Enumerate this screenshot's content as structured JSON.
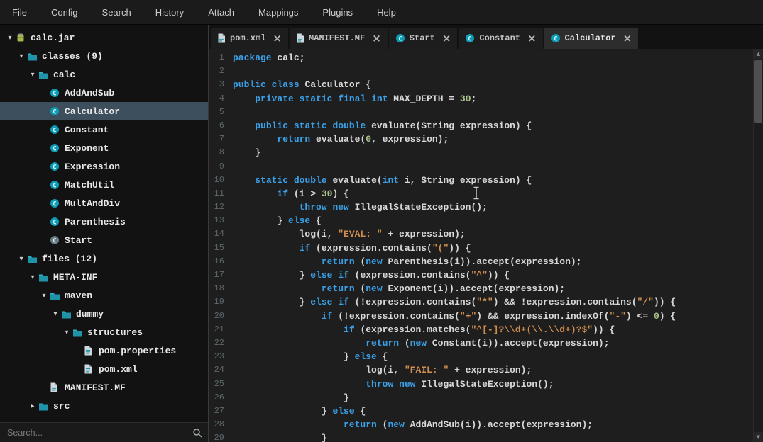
{
  "colors": {
    "accent_teal": "#1f93a8",
    "keyword_blue": "#3aa0e8",
    "string_orange": "#cf8e4e",
    "number_green": "#aac38c",
    "selection_bg": "#3d4f5d"
  },
  "icons": {
    "scroll_up": "▲",
    "scroll_down": "▼",
    "close": "×",
    "collapse": "▾",
    "expand": "▸"
  },
  "menubar": {
    "items": [
      "File",
      "Config",
      "Search",
      "History",
      "Attach",
      "Mappings",
      "Plugins",
      "Help"
    ]
  },
  "sidebar": {
    "tree": [
      {
        "label": "calc.jar",
        "level": 0,
        "icon": "jar",
        "arrow": "down"
      },
      {
        "label": "classes (9)",
        "level": 1,
        "icon": "folder",
        "arrow": "down"
      },
      {
        "label": "calc",
        "level": 2,
        "icon": "folder",
        "arrow": "down"
      },
      {
        "label": "AddAndSub",
        "level": 3,
        "icon": "class"
      },
      {
        "label": "Calculator",
        "level": 3,
        "icon": "class",
        "selected": true
      },
      {
        "label": "Constant",
        "level": 3,
        "icon": "class"
      },
      {
        "label": "Exponent",
        "level": 3,
        "icon": "class"
      },
      {
        "label": "Expression",
        "level": 3,
        "icon": "class"
      },
      {
        "label": "MatchUtil",
        "level": 3,
        "icon": "class"
      },
      {
        "label": "MultAndDiv",
        "level": 3,
        "icon": "class"
      },
      {
        "label": "Parenthesis",
        "level": 3,
        "icon": "class"
      },
      {
        "label": "Start",
        "level": 3,
        "icon": "class-gray"
      },
      {
        "label": "files (12)",
        "level": 1,
        "icon": "folder",
        "arrow": "down"
      },
      {
        "label": "META-INF",
        "level": 2,
        "icon": "folder",
        "arrow": "down"
      },
      {
        "label": "maven",
        "level": 3,
        "icon": "folder",
        "arrow": "down"
      },
      {
        "label": "dummy",
        "level": 4,
        "icon": "folder",
        "arrow": "down"
      },
      {
        "label": "structures",
        "level": 5,
        "icon": "folder",
        "arrow": "down"
      },
      {
        "label": "pom.properties",
        "level": 6,
        "icon": "file"
      },
      {
        "label": "pom.xml",
        "level": 6,
        "icon": "file"
      },
      {
        "label": "MANIFEST.MF",
        "level": 3,
        "icon": "file"
      },
      {
        "label": "src",
        "level": 2,
        "icon": "folder",
        "arrow": "right"
      }
    ],
    "search": {
      "placeholder": "Search..."
    }
  },
  "tabs": [
    {
      "label": "pom.xml",
      "icon": "file",
      "active": false
    },
    {
      "label": "MANIFEST.MF",
      "icon": "file",
      "active": false
    },
    {
      "label": "Start",
      "icon": "class",
      "active": false
    },
    {
      "label": "Constant",
      "icon": "class",
      "active": false
    },
    {
      "label": "Calculator",
      "icon": "class",
      "active": true
    }
  ],
  "editor": {
    "lines": [
      [
        [
          "kw",
          "package"
        ],
        [
          "pl",
          " calc;"
        ]
      ],
      [],
      [
        [
          "kw",
          "public"
        ],
        [
          "pl",
          " "
        ],
        [
          "kw",
          "class"
        ],
        [
          "pl",
          " Calculator {"
        ]
      ],
      [
        [
          "pl",
          "    "
        ],
        [
          "kw",
          "private"
        ],
        [
          "pl",
          " "
        ],
        [
          "kw",
          "static"
        ],
        [
          "pl",
          " "
        ],
        [
          "kw",
          "final"
        ],
        [
          "pl",
          " "
        ],
        [
          "kw",
          "int"
        ],
        [
          "pl",
          " MAX_DEPTH = "
        ],
        [
          "num",
          "30"
        ],
        [
          "pl",
          ";"
        ]
      ],
      [],
      [
        [
          "pl",
          "    "
        ],
        [
          "kw",
          "public"
        ],
        [
          "pl",
          " "
        ],
        [
          "kw",
          "static"
        ],
        [
          "pl",
          " "
        ],
        [
          "kw",
          "double"
        ],
        [
          "pl",
          " evaluate(String expression) {"
        ]
      ],
      [
        [
          "pl",
          "        "
        ],
        [
          "kw",
          "return"
        ],
        [
          "pl",
          " evaluate("
        ],
        [
          "num",
          "0"
        ],
        [
          "pl",
          ", expression);"
        ]
      ],
      [
        [
          "pl",
          "    }"
        ]
      ],
      [],
      [
        [
          "pl",
          "    "
        ],
        [
          "kw",
          "static"
        ],
        [
          "pl",
          " "
        ],
        [
          "kw",
          "double"
        ],
        [
          "pl",
          " evaluate("
        ],
        [
          "kw",
          "int"
        ],
        [
          "pl",
          " i, String expression) {"
        ]
      ],
      [
        [
          "pl",
          "        "
        ],
        [
          "kw",
          "if"
        ],
        [
          "pl",
          " (i > "
        ],
        [
          "num",
          "30"
        ],
        [
          "pl",
          ") {"
        ]
      ],
      [
        [
          "pl",
          "            "
        ],
        [
          "kw",
          "throw"
        ],
        [
          "pl",
          " "
        ],
        [
          "kw",
          "new"
        ],
        [
          "pl",
          " IllegalStateException();"
        ]
      ],
      [
        [
          "pl",
          "        } "
        ],
        [
          "kw",
          "else"
        ],
        [
          "pl",
          " {"
        ]
      ],
      [
        [
          "pl",
          "            log(i, "
        ],
        [
          "str",
          "\"EVAL: \""
        ],
        [
          "pl",
          " + expression);"
        ]
      ],
      [
        [
          "pl",
          "            "
        ],
        [
          "kw",
          "if"
        ],
        [
          "pl",
          " (expression.contains("
        ],
        [
          "str",
          "\"(\""
        ],
        [
          "pl",
          ")) {"
        ]
      ],
      [
        [
          "pl",
          "                "
        ],
        [
          "kw",
          "return"
        ],
        [
          "pl",
          " ("
        ],
        [
          "kw",
          "new"
        ],
        [
          "pl",
          " Parenthesis(i)).accept(expression);"
        ]
      ],
      [
        [
          "pl",
          "            } "
        ],
        [
          "kw",
          "else"
        ],
        [
          "pl",
          " "
        ],
        [
          "kw",
          "if"
        ],
        [
          "pl",
          " (expression.contains("
        ],
        [
          "str",
          "\"^\""
        ],
        [
          "pl",
          ")) {"
        ]
      ],
      [
        [
          "pl",
          "                "
        ],
        [
          "kw",
          "return"
        ],
        [
          "pl",
          " ("
        ],
        [
          "kw",
          "new"
        ],
        [
          "pl",
          " Exponent(i)).accept(expression);"
        ]
      ],
      [
        [
          "pl",
          "            } "
        ],
        [
          "kw",
          "else"
        ],
        [
          "pl",
          " "
        ],
        [
          "kw",
          "if"
        ],
        [
          "pl",
          " (!expression.contains("
        ],
        [
          "str",
          "\"*\""
        ],
        [
          "pl",
          ") && !expression.contains("
        ],
        [
          "str",
          "\"/\""
        ],
        [
          "pl",
          ")) {"
        ]
      ],
      [
        [
          "pl",
          "                "
        ],
        [
          "kw",
          "if"
        ],
        [
          "pl",
          " (!expression.contains("
        ],
        [
          "str",
          "\"+\""
        ],
        [
          "pl",
          ") && expression.indexOf("
        ],
        [
          "str",
          "\"-\""
        ],
        [
          "pl",
          ") <= "
        ],
        [
          "num",
          "0"
        ],
        [
          "pl",
          ") {"
        ]
      ],
      [
        [
          "pl",
          "                    "
        ],
        [
          "kw",
          "if"
        ],
        [
          "pl",
          " (expression.matches("
        ],
        [
          "str",
          "\"^[-]?\\\\d+(\\\\.\\\\d+)?$\""
        ],
        [
          "pl",
          ")) {"
        ]
      ],
      [
        [
          "pl",
          "                        "
        ],
        [
          "kw",
          "return"
        ],
        [
          "pl",
          " ("
        ],
        [
          "kw",
          "new"
        ],
        [
          "pl",
          " Constant(i)).accept(expression);"
        ]
      ],
      [
        [
          "pl",
          "                    } "
        ],
        [
          "kw",
          "else"
        ],
        [
          "pl",
          " {"
        ]
      ],
      [
        [
          "pl",
          "                        log(i, "
        ],
        [
          "str",
          "\"FAIL: \""
        ],
        [
          "pl",
          " + expression);"
        ]
      ],
      [
        [
          "pl",
          "                        "
        ],
        [
          "kw",
          "throw"
        ],
        [
          "pl",
          " "
        ],
        [
          "kw",
          "new"
        ],
        [
          "pl",
          " IllegalStateException();"
        ]
      ],
      [
        [
          "pl",
          "                    }"
        ]
      ],
      [
        [
          "pl",
          "                } "
        ],
        [
          "kw",
          "else"
        ],
        [
          "pl",
          " {"
        ]
      ],
      [
        [
          "pl",
          "                    "
        ],
        [
          "kw",
          "return"
        ],
        [
          "pl",
          " ("
        ],
        [
          "kw",
          "new"
        ],
        [
          "pl",
          " AddAndSub(i)).accept(expression);"
        ]
      ],
      [
        [
          "pl",
          "                }"
        ]
      ]
    ]
  }
}
